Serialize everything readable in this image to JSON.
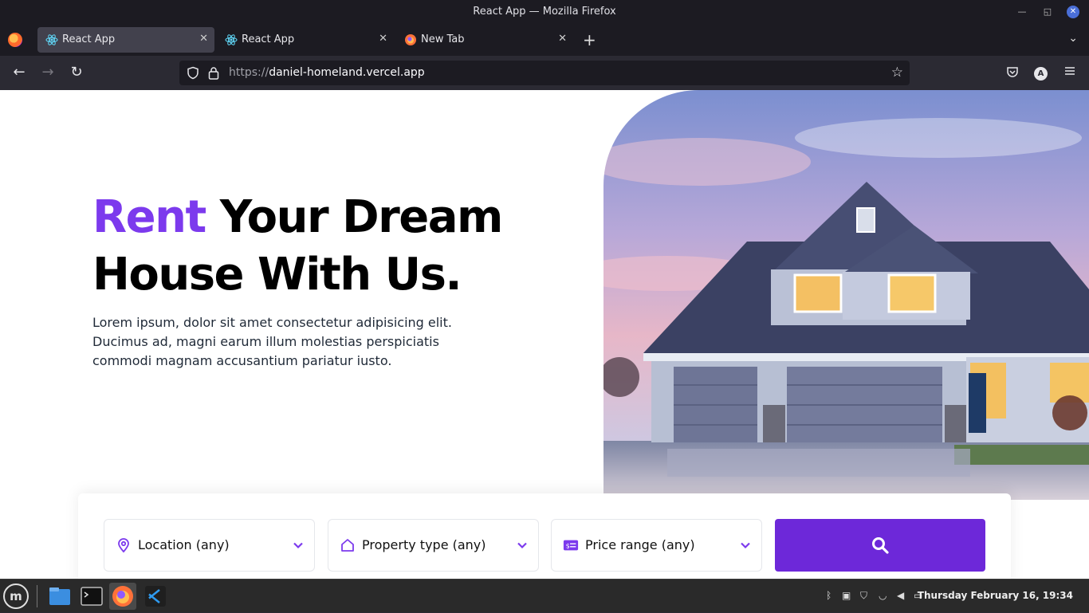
{
  "window": {
    "title": "React App — Mozilla Firefox"
  },
  "tabs": [
    {
      "label": "React App",
      "active": true
    },
    {
      "label": "React App",
      "active": false
    },
    {
      "label": "New Tab",
      "active": false
    }
  ],
  "urlbar": {
    "scheme": "https://",
    "host": "daniel-homeland.vercel.app"
  },
  "account": {
    "initial": "A"
  },
  "hero": {
    "title_accent": "Rent",
    "title_rest_line1": " Your Dream",
    "title_line2": "House With Us.",
    "description": "Lorem ipsum, dolor sit amet consectetur adipisicing elit. Ducimus ad, magni earum illum molestias perspiciatis commodi magnam accusantium pariatur iusto."
  },
  "search": {
    "location_label": "Location (any)",
    "property_label": "Property type (any)",
    "price_label": "Price range (any)"
  },
  "colors": {
    "accent": "#7c3aed",
    "button": "#6d28d9"
  },
  "taskbar": {
    "clock": "Thursday February 16, 19:34",
    "apps": [
      "file-manager",
      "terminal",
      "firefox",
      "vscode"
    ]
  }
}
